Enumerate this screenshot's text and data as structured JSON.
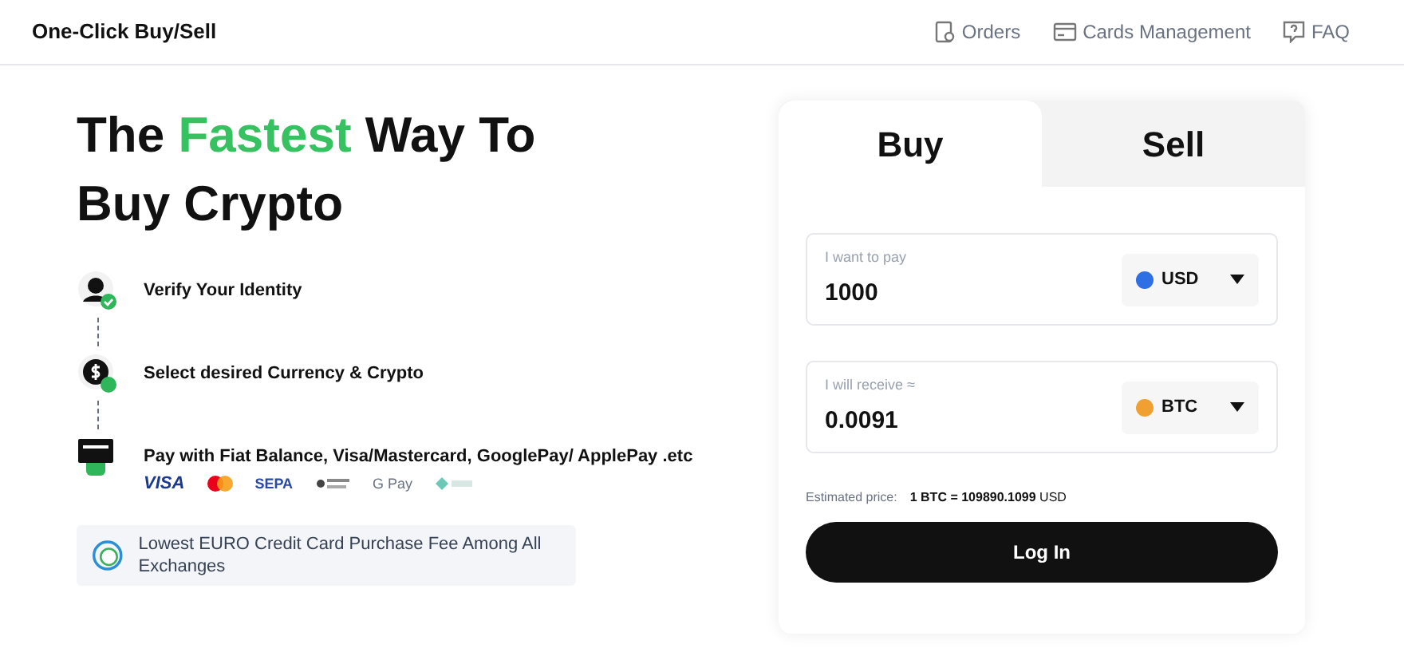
{
  "header": {
    "title": "One-Click Buy/Sell",
    "links": [
      {
        "kind": "orders",
        "label": "Orders"
      },
      {
        "kind": "cards",
        "label": "Cards Management"
      },
      {
        "kind": "faq",
        "label": "FAQ"
      }
    ]
  },
  "hero": {
    "heading": [
      {
        "text": "The ",
        "accent": false
      },
      {
        "text": "Fastest",
        "accent": true
      },
      {
        "text": " Way To Buy Crypto",
        "accent": false
      }
    ]
  },
  "steps": [
    {
      "kind": "identity",
      "label": "Verify Your Identity"
    },
    {
      "kind": "currency",
      "label": "Select desired Currency & Crypto"
    },
    {
      "kind": "payment",
      "label": "Pay with Fiat Balance, Visa/Mastercard, GooglePay/ ApplePay .etc"
    }
  ],
  "payment_logos": [
    {
      "kind": "visa",
      "text": "VISA"
    },
    {
      "kind": "mastercard"
    },
    {
      "kind": "sepa",
      "text": "SEPA"
    },
    {
      "kind": "bank"
    },
    {
      "kind": "gpay",
      "text": "G Pay"
    },
    {
      "kind": "other"
    }
  ],
  "promo": {
    "text": "Lowest EURO Credit Card Purchase Fee Among All Exchanges"
  },
  "trade": {
    "tabs": [
      {
        "label": "Buy",
        "selected": true
      },
      {
        "label": "Sell",
        "selected": false
      }
    ],
    "fields": [
      {
        "label": "I want to pay",
        "value": "1000",
        "currency": "USD",
        "color": "#2f6fe4"
      },
      {
        "label": "I will receive ≈",
        "value": "0.0091",
        "currency": "BTC",
        "color": "#f0a030"
      }
    ],
    "estimate_label": "Estimated price:",
    "estimate_value": "**1 BTC = 109890.1099** USD",
    "button": "Log In"
  }
}
